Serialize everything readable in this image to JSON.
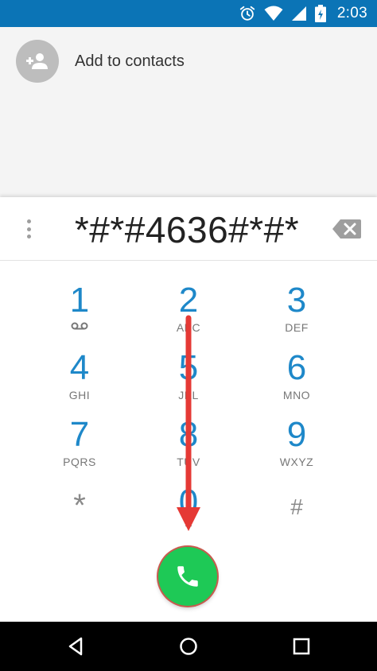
{
  "status_bar": {
    "time": "2:03",
    "icons": [
      "alarm-icon",
      "wifi-icon",
      "signal-icon",
      "battery-charging-icon"
    ],
    "color": "#0b74b6"
  },
  "contact": {
    "add_label": "Add to contacts",
    "avatar_icon": "add-person-icon"
  },
  "dialer": {
    "digits": "*#*#4636#*#*",
    "overflow_icon": "more-vert-icon",
    "backspace_icon": "backspace-icon"
  },
  "keypad": {
    "k1": {
      "digit": "1",
      "letters": ""
    },
    "k2": {
      "digit": "2",
      "letters": "ABC"
    },
    "k3": {
      "digit": "3",
      "letters": "DEF"
    },
    "k4": {
      "digit": "4",
      "letters": "GHI"
    },
    "k5": {
      "digit": "5",
      "letters": "JKL"
    },
    "k6": {
      "digit": "6",
      "letters": "MNO"
    },
    "k7": {
      "digit": "7",
      "letters": "PQRS"
    },
    "k8": {
      "digit": "8",
      "letters": "TUV"
    },
    "k9": {
      "digit": "9",
      "letters": "WXYZ"
    },
    "kstar": {
      "digit": "*"
    },
    "k0": {
      "digit": "0",
      "letters": "+"
    },
    "khash": {
      "digit": "#"
    }
  },
  "call_button": {
    "icon": "phone-icon",
    "color": "#1ec956"
  },
  "annotation": {
    "color": "#e53935",
    "icon": "arrow-down-annotation"
  },
  "nav": {
    "back_icon": "back-icon",
    "home_icon": "home-icon",
    "recents_icon": "recents-icon"
  }
}
